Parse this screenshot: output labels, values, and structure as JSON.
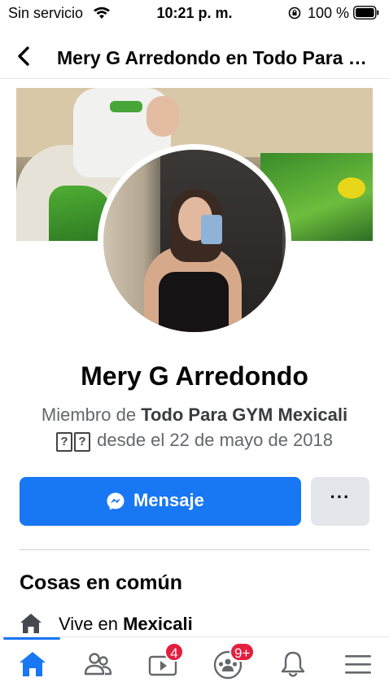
{
  "status_bar": {
    "carrier": "Sin servicio",
    "time": "10:21 p. m.",
    "battery": "100 %"
  },
  "header": {
    "title": "Mery G Arredondo en Todo Para GYM Mexicali"
  },
  "profile": {
    "name": "Mery G Arredondo",
    "member_prefix": "Miembro de ",
    "group_name": "Todo Para GYM Mexicali",
    "unknown_glyphs": [
      "?",
      "?"
    ],
    "member_since": "desde el 22 de mayo de 2018"
  },
  "actions": {
    "message_label": "Mensaje",
    "more_label": "···"
  },
  "common": {
    "title": "Cosas en común",
    "lives_prefix": "Vive en ",
    "lives_city": "Mexicali"
  },
  "tabbar": {
    "video_badge": "4",
    "groups_badge": "9+"
  },
  "colors": {
    "accent": "#1877f2",
    "badge": "#e41e3f"
  }
}
